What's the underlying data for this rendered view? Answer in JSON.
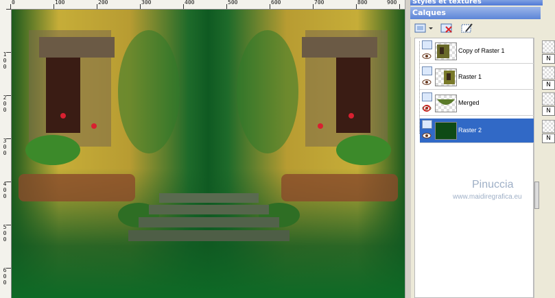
{
  "panels": {
    "styles_title": "Styles et textures",
    "layers_title": "Calques"
  },
  "ruler": {
    "top_labels": [
      "0",
      "100",
      "200",
      "300",
      "400",
      "500",
      "600",
      "700",
      "800",
      "900"
    ],
    "left_labels": [
      [
        "1",
        "0",
        "0"
      ],
      [
        "2",
        "0",
        "0"
      ],
      [
        "3",
        "0",
        "0"
      ],
      [
        "4",
        "0",
        "0"
      ],
      [
        "5",
        "0",
        "0"
      ],
      [
        "6",
        "0",
        "0"
      ]
    ]
  },
  "layers": [
    {
      "name": "Copy of Raster 1",
      "visible": true,
      "selected": false,
      "thumb": "garden-half-image"
    },
    {
      "name": "Raster 1",
      "visible": true,
      "selected": false,
      "thumb": "garden-half-image"
    },
    {
      "name": "Merged",
      "visible": false,
      "selected": false,
      "thumb": "green-arc"
    },
    {
      "name": "Raster 2",
      "visible": true,
      "selected": true,
      "thumb": "solid-dark-green"
    }
  ],
  "toolbar_icons": [
    "new-layer-icon",
    "dropdown-arrow-icon",
    "delete-layer-icon",
    "properties-icon"
  ],
  "side_values": [
    "N",
    "N",
    "N",
    "N"
  ],
  "watermark": {
    "name": "Pinuccia",
    "url": "www.maidiregrafica.eu"
  },
  "colors": {
    "panel_header": "#5c85d8",
    "selection": "#3169c6",
    "canvas_green": "#0e6a26"
  }
}
